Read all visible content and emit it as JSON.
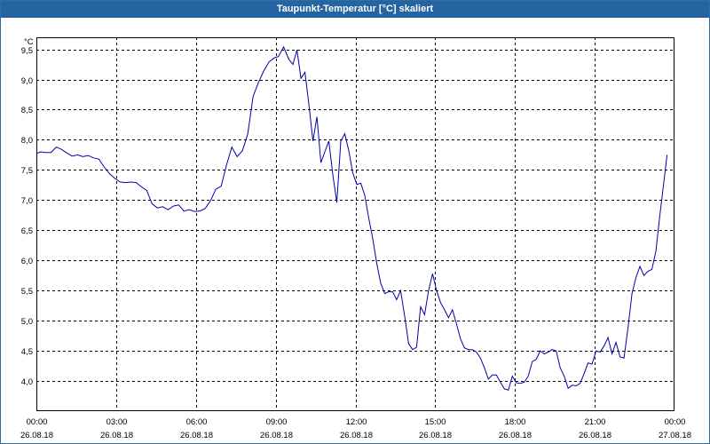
{
  "window": {
    "title": "Taupunkt-Temperatur [°C] skaliert"
  },
  "chart_data": {
    "type": "line",
    "title": "Taupunkt-Temperatur [°C] skaliert",
    "ylabel": "°C",
    "xlabel": "",
    "ylim": [
      3.5,
      9.7
    ],
    "xlim": [
      0,
      24
    ],
    "grid": true,
    "y_ticks": [
      "9,5",
      "9,0",
      "8,5",
      "8,0",
      "7,5",
      "7,0",
      "6,5",
      "6,0",
      "5,5",
      "5,0",
      "4,5",
      "4,0"
    ],
    "x_ticks": [
      {
        "time": "00:00",
        "date": "26.08.18"
      },
      {
        "time": "03:00",
        "date": "26.08.18"
      },
      {
        "time": "06:00",
        "date": "26.08.18"
      },
      {
        "time": "09:00",
        "date": "26.08.18"
      },
      {
        "time": "12:00",
        "date": "26.08.18"
      },
      {
        "time": "15:00",
        "date": "26.08.18"
      },
      {
        "time": "18:00",
        "date": "26.08.18"
      },
      {
        "time": "21:00",
        "date": "26.08.18"
      },
      {
        "time": "00:00",
        "date": "27.08.18"
      }
    ],
    "series": [
      {
        "color": "#0000aa",
        "points": [
          [
            0.0,
            7.77
          ],
          [
            0.15,
            7.8
          ],
          [
            0.35,
            7.79
          ],
          [
            0.55,
            7.79
          ],
          [
            0.75,
            7.88
          ],
          [
            0.95,
            7.84
          ],
          [
            1.15,
            7.78
          ],
          [
            1.35,
            7.73
          ],
          [
            1.55,
            7.75
          ],
          [
            1.75,
            7.72
          ],
          [
            1.95,
            7.74
          ],
          [
            2.15,
            7.7
          ],
          [
            2.35,
            7.68
          ],
          [
            2.55,
            7.55
          ],
          [
            2.75,
            7.44
          ],
          [
            2.95,
            7.36
          ],
          [
            3.15,
            7.3
          ],
          [
            3.35,
            7.29
          ],
          [
            3.55,
            7.3
          ],
          [
            3.75,
            7.29
          ],
          [
            3.95,
            7.22
          ],
          [
            4.15,
            7.16
          ],
          [
            4.35,
            6.94
          ],
          [
            4.55,
            6.87
          ],
          [
            4.75,
            6.89
          ],
          [
            4.95,
            6.84
          ],
          [
            5.15,
            6.9
          ],
          [
            5.35,
            6.92
          ],
          [
            5.55,
            6.82
          ],
          [
            5.75,
            6.84
          ],
          [
            5.95,
            6.81
          ],
          [
            6.15,
            6.82
          ],
          [
            6.35,
            6.86
          ],
          [
            6.55,
            6.99
          ],
          [
            6.75,
            7.18
          ],
          [
            6.95,
            7.23
          ],
          [
            7.15,
            7.58
          ],
          [
            7.35,
            7.88
          ],
          [
            7.55,
            7.72
          ],
          [
            7.75,
            7.82
          ],
          [
            7.95,
            8.1
          ],
          [
            8.15,
            8.72
          ],
          [
            8.35,
            8.95
          ],
          [
            8.55,
            9.14
          ],
          [
            8.75,
            9.29
          ],
          [
            8.95,
            9.36
          ],
          [
            9.1,
            9.38
          ],
          [
            9.3,
            9.54
          ],
          [
            9.5,
            9.33
          ],
          [
            9.65,
            9.25
          ],
          [
            9.8,
            9.49
          ],
          [
            9.95,
            9.02
          ],
          [
            10.1,
            9.12
          ],
          [
            10.25,
            8.58
          ],
          [
            10.4,
            7.98
          ],
          [
            10.55,
            8.38
          ],
          [
            10.7,
            7.62
          ],
          [
            10.85,
            7.8
          ],
          [
            11.0,
            7.98
          ],
          [
            11.15,
            7.42
          ],
          [
            11.3,
            6.96
          ],
          [
            11.45,
            7.98
          ],
          [
            11.6,
            8.1
          ],
          [
            11.75,
            7.82
          ],
          [
            11.9,
            7.45
          ],
          [
            12.05,
            7.26
          ],
          [
            12.2,
            7.28
          ],
          [
            12.35,
            7.08
          ],
          [
            12.5,
            6.7
          ],
          [
            12.65,
            6.36
          ],
          [
            12.8,
            5.95
          ],
          [
            12.95,
            5.62
          ],
          [
            13.1,
            5.45
          ],
          [
            13.25,
            5.48
          ],
          [
            13.4,
            5.48
          ],
          [
            13.55,
            5.35
          ],
          [
            13.7,
            5.5
          ],
          [
            13.85,
            5.08
          ],
          [
            14.0,
            4.62
          ],
          [
            14.15,
            4.52
          ],
          [
            14.3,
            4.56
          ],
          [
            14.45,
            5.23
          ],
          [
            14.6,
            5.1
          ],
          [
            14.75,
            5.5
          ],
          [
            14.9,
            5.78
          ],
          [
            15.05,
            5.5
          ],
          [
            15.2,
            5.3
          ],
          [
            15.35,
            5.18
          ],
          [
            15.5,
            5.05
          ],
          [
            15.65,
            5.18
          ],
          [
            15.8,
            4.95
          ],
          [
            15.95,
            4.7
          ],
          [
            16.1,
            4.55
          ],
          [
            16.25,
            4.52
          ],
          [
            16.4,
            4.52
          ],
          [
            16.55,
            4.48
          ],
          [
            16.7,
            4.38
          ],
          [
            16.85,
            4.22
          ],
          [
            17.0,
            4.03
          ],
          [
            17.15,
            4.1
          ],
          [
            17.3,
            4.1
          ],
          [
            17.45,
            3.98
          ],
          [
            17.6,
            3.87
          ],
          [
            17.75,
            3.85
          ],
          [
            17.9,
            4.08
          ],
          [
            18.05,
            3.97
          ],
          [
            18.2,
            3.96
          ],
          [
            18.35,
            3.98
          ],
          [
            18.5,
            4.08
          ],
          [
            18.65,
            4.32
          ],
          [
            18.8,
            4.36
          ],
          [
            18.95,
            4.5
          ],
          [
            19.1,
            4.45
          ],
          [
            19.25,
            4.48
          ],
          [
            19.4,
            4.52
          ],
          [
            19.55,
            4.5
          ],
          [
            19.7,
            4.22
          ],
          [
            19.85,
            4.08
          ],
          [
            20.0,
            3.88
          ],
          [
            20.15,
            3.93
          ],
          [
            20.3,
            3.92
          ],
          [
            20.45,
            3.96
          ],
          [
            20.6,
            4.12
          ],
          [
            20.75,
            4.3
          ],
          [
            20.9,
            4.28
          ],
          [
            21.05,
            4.5
          ],
          [
            21.2,
            4.48
          ],
          [
            21.35,
            4.58
          ],
          [
            21.5,
            4.72
          ],
          [
            21.65,
            4.45
          ],
          [
            21.8,
            4.64
          ],
          [
            21.95,
            4.4
          ],
          [
            22.1,
            4.38
          ],
          [
            22.25,
            4.88
          ],
          [
            22.4,
            5.45
          ],
          [
            22.55,
            5.72
          ],
          [
            22.7,
            5.9
          ],
          [
            22.85,
            5.75
          ],
          [
            23.0,
            5.82
          ],
          [
            23.15,
            5.85
          ],
          [
            23.3,
            6.15
          ],
          [
            23.45,
            6.75
          ],
          [
            23.6,
            7.3
          ],
          [
            23.72,
            7.75
          ]
        ]
      }
    ]
  }
}
